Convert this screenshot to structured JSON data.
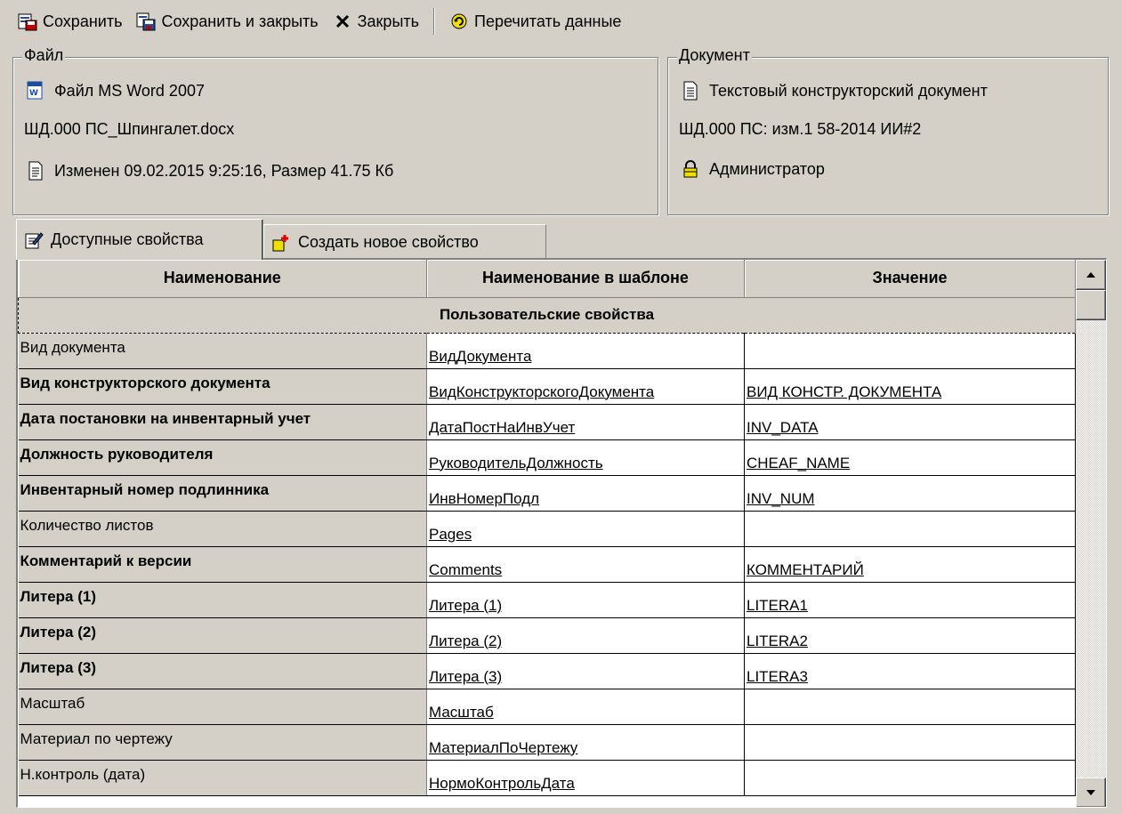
{
  "toolbar": {
    "save_label": "Сохранить",
    "save_close_label": "Сохранить и закрыть",
    "close_label": "Закрыть",
    "reread_label": "Перечитать данные"
  },
  "file_group": {
    "title": "Файл",
    "type_label": "Файл MS Word 2007",
    "filename": "ШД.000 ПС_Шпингалет.docx",
    "info": "Изменен 09.02.2015 9:25:16, Размер 41.75 Кб"
  },
  "doc_group": {
    "title": "Документ",
    "type_label": "Текстовый конструкторский документ",
    "designation": "ШД.000 ПС: изм.1 58-2014 ИИ#2",
    "owner": "Администратор"
  },
  "tabs": [
    {
      "label": "Доступные свойства"
    },
    {
      "label": "Создать новое свойство"
    }
  ],
  "grid": {
    "columns": [
      "Наименование",
      "Наименование в шаблоне",
      "Значение"
    ],
    "group_label": "Пользовательские свойства",
    "rows": [
      {
        "name": "Вид документа",
        "template": "ВидДокумента",
        "value": "",
        "bold": false
      },
      {
        "name": "Вид конструкторского документа",
        "template": "ВидКонструкторскогоДокумента",
        "value": "ВИД КОНСТР. ДОКУМЕНТА",
        "bold": true
      },
      {
        "name": "Дата постановки на инвентарный учет",
        "template": "ДатаПостНаИнвУчет",
        "value": "INV_DATA",
        "bold": true
      },
      {
        "name": "Должность руководителя",
        "template": "РуководительДолжность",
        "value": "CHEAF_NAME",
        "bold": true
      },
      {
        "name": "Инвентарный номер подлинника",
        "template": "ИнвНомерПодл",
        "value": "INV_NUM",
        "bold": true
      },
      {
        "name": "Количество листов",
        "template": "Pages",
        "value": "",
        "bold": false
      },
      {
        "name": "Комментарий к версии",
        "template": "Comments",
        "value": "КОММЕНТАРИЙ",
        "bold": true
      },
      {
        "name": "Литера (1)",
        "template": "Литера (1)",
        "value": "LITERA1",
        "bold": true
      },
      {
        "name": "Литера (2)",
        "template": "Литера (2)",
        "value": "LITERA2",
        "bold": true
      },
      {
        "name": "Литера (3)",
        "template": "Литера (3)",
        "value": "LITERA3",
        "bold": true
      },
      {
        "name": "Масштаб",
        "template": "Масштаб",
        "value": "",
        "bold": false
      },
      {
        "name": "Материал по чертежу",
        "template": "МатериалПоЧертежу",
        "value": "",
        "bold": false
      },
      {
        "name": "Н.контроль (дата)",
        "template": "НормоКонтрольДата",
        "value": "",
        "bold": false
      }
    ]
  }
}
